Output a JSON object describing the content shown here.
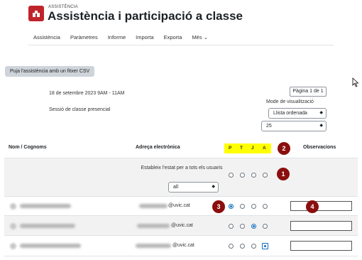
{
  "header": {
    "kicker": "ASSISTÈNCIA",
    "title": "Assistència i participació a classe"
  },
  "nav": [
    "Assistència",
    "Paràmetres",
    "Informe",
    "Importa",
    "Exporta",
    "Més"
  ],
  "toolbar": {
    "csv_label": "Puja l'assistència amb un fitxer CSV"
  },
  "session": {
    "date": "18 de setembre 2023 9AM - 11AM",
    "type": "Sessió de classe presencial"
  },
  "pager": {
    "page": "Pàgina 1 de 1",
    "view_label": "Mode de visualització",
    "view_value": "Llista ordenada",
    "per_page": "25"
  },
  "table": {
    "col_name": "Nom / Cognoms",
    "col_email": "Adreça electrònica",
    "statuses": [
      "P",
      "T",
      "J",
      "A"
    ],
    "col_obs": "Observacions",
    "bulk_text": "Estableix l'estat per a tots els usuaris",
    "bulk_value": "all",
    "rows": [
      {
        "email_domain": "@uvic.cat",
        "selected": 0
      },
      {
        "email_domain": "@uvic.cat",
        "selected": 2
      },
      {
        "email_domain": "@uvic.cat",
        "selected": 3
      }
    ]
  },
  "badges": [
    "1",
    "2",
    "3",
    "4"
  ],
  "colors": {
    "brand": "#c0242b",
    "badge": "#8b0e0e",
    "highlight": "#ffff00",
    "radio_on": "#0f6cbf"
  }
}
